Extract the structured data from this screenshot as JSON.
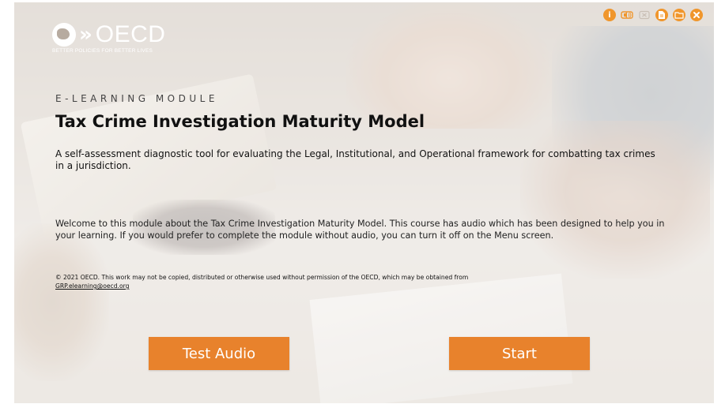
{
  "brand": {
    "name": "OECD",
    "tagline": "BETTER POLICIES FOR BETTER LIVES",
    "chevrons": "»"
  },
  "toolbar": {
    "icons": [
      "info-icon",
      "audio-icon",
      "close-captions-icon",
      "document-icon",
      "folder-icon",
      "exit-icon"
    ],
    "info_glyph": "i"
  },
  "module": {
    "eyebrow": "E-LEARNING MODULE",
    "title": "Tax Crime Investigation Maturity Model",
    "subtitle": "A self-assessment diagnostic tool for evaluating the Legal, Institutional, and Operational framework for combatting tax crimes in a jurisdiction.",
    "welcome": "Welcome to this module about the Tax Crime Investigation Maturity Model. This course has audio which has been designed to help you in your learning. If you would prefer to complete the module without audio, you can turn it off on the Menu screen.",
    "copyright": "© 2021 OECD. This work may not be copied, distributed or otherwise used without permission of the OECD, which may be obtained from",
    "contact_email": "GRP.elearning@oecd.org"
  },
  "buttons": {
    "test_audio": "Test Audio",
    "start": "Start"
  },
  "colors": {
    "accent": "#e8822c",
    "toolbar_accent": "#f0962c"
  }
}
